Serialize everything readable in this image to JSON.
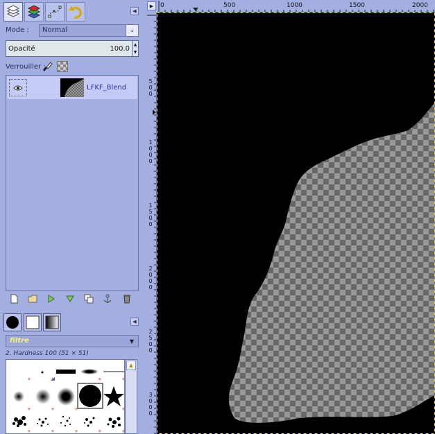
{
  "dock": {
    "tabs": [
      {
        "icon": "layers-icon"
      },
      {
        "icon": "channels-icon"
      },
      {
        "icon": "paths-icon"
      },
      {
        "icon": "undo-history-icon"
      }
    ],
    "mode_label": "Mode :",
    "mode_value": "Normal",
    "opacity_label": "Opacité",
    "opacity_value": "100.0",
    "lock_label": "Verrouiller :",
    "layers": [
      {
        "name": "LFKF_Blend",
        "visible": true
      }
    ],
    "layer_tools": [
      "new-layer-icon",
      "new-layer-group-icon",
      "raise-layer-icon",
      "lower-layer-icon",
      "duplicate-layer-icon",
      "anchor-layer-icon",
      "delete-layer-icon"
    ],
    "brush_tabs": [
      "brushes-icon",
      "patterns-icon",
      "gradients-icon"
    ],
    "brush_filter": "filtre",
    "brush_name": "2. Hardness 100 (51 × 51)"
  },
  "canvas": {
    "hruler_labels": [
      "0",
      "500",
      "1000",
      "1500",
      "2000"
    ],
    "vruler_labels": [
      "5\n0\n0",
      "1\n0\n0\n0",
      "1\n5\n0\n0",
      "2\n0\n0\n0",
      "2\n5\n0\n0",
      "3\n0\n0\n0"
    ],
    "colors": {
      "background": "#000000",
      "checker_dark": "#666666",
      "checker_light": "#999999"
    }
  }
}
